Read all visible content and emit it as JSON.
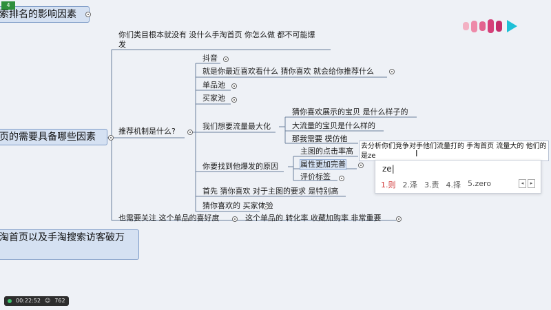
{
  "logo": {
    "colors": [
      "#f3b1c3",
      "#ee8aa9",
      "#e3638f",
      "#d54079",
      "#c42e6a"
    ],
    "play": "#1ec0d7"
  },
  "mindmap": {
    "root_nodes": [
      {
        "text": "索排名的影响因素"
      },
      {
        "text": "页的需要具备哪些因素"
      },
      {
        "text": "淘首页以及手淘搜索访客破万"
      }
    ],
    "top_text": "你们类目根本就没有 没什么手淘首页 你怎么做 都不可能爆",
    "top_text_cont": "发",
    "recommend": "推荐机制是什么?",
    "douyin": "抖音",
    "guess_line": "就是你最近喜欢看什么  猜你喜欢 就会给你推荐什么",
    "single_pool": "单品池",
    "buyer_pool": "买家池",
    "max_traffic": "我们想要流量最大化",
    "guess_show": "猜你喜欢展示的宝贝 是什么样子的",
    "big_traffic": "大流量的宝贝是什么样的",
    "imitate": "那我需要 模仿他",
    "find_reason": "你要找到他爆发的原因",
    "ctr": "主图的点击率高",
    "attributes": "属性更加完善",
    "eval_tags": "评价标签",
    "first_guess": "首先 猜你喜欢 对于主图的要求 是特别高",
    "buyer_exp": "猜你喜欢的 买家体验",
    "pay_attention": "也需要关注 这个单品的喜好度",
    "conversion": "这个单品的 转化率 收藏加购率 非常重要"
  },
  "ime": {
    "inline_text_1": "去分析你们竞争对手他们流量打的 手淘首页 流量大的 他们的",
    "inline_text_2": "是ze",
    "composition": "ze",
    "candidates": [
      "1.则",
      "2.泽",
      "3.责",
      "4.择",
      "5.zero"
    ]
  },
  "status": {
    "time": "00:22:52",
    "count": "762"
  },
  "corner": "4",
  "colors": {
    "node_bg": "#d5e1f2",
    "node_border": "#7e9cc7",
    "line": "#6b7f9c",
    "cand_highlight": "#d23c3c"
  }
}
